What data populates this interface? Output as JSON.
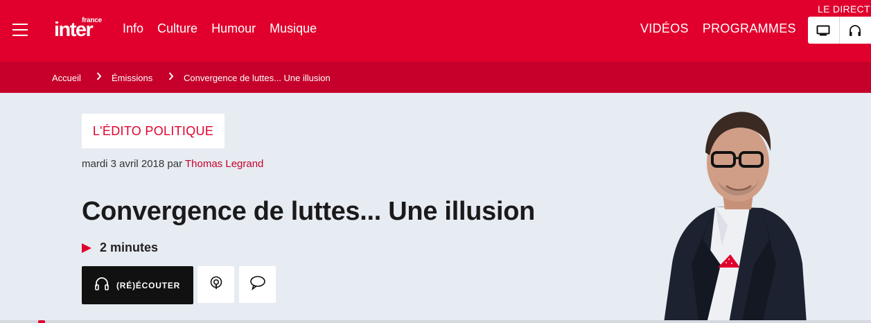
{
  "header": {
    "logo_small": "france",
    "logo_main": "inter",
    "menu_icon": "hamburger-icon",
    "nav": [
      "Info",
      "Culture",
      "Humour",
      "Musique"
    ],
    "nav_right": [
      "VIDÉOS",
      "PROGRAMMES"
    ],
    "direct_label": "LE DIRECT",
    "direct_icons": [
      "tv-icon",
      "headphones-icon"
    ]
  },
  "breadcrumb": {
    "items": [
      "Accueil",
      "Émissions",
      "Convergence de luttes... Une illusion"
    ],
    "separator": "›"
  },
  "article": {
    "show_tag": "L'ÉDITO POLITIQUE",
    "date": "mardi 3 avril 2018",
    "by": "par",
    "author": "Thomas Legrand",
    "title": "Convergence de luttes... Une illusion",
    "duration": "2 minutes",
    "listen_label": "(RÉ)ÉCOUTER",
    "action_icons": [
      "podcast-icon",
      "comment-icon"
    ]
  },
  "colors": {
    "brand_red": "#e1002d",
    "breadcrumb_red": "#c6002a",
    "page_bg": "#e7ebf2"
  }
}
